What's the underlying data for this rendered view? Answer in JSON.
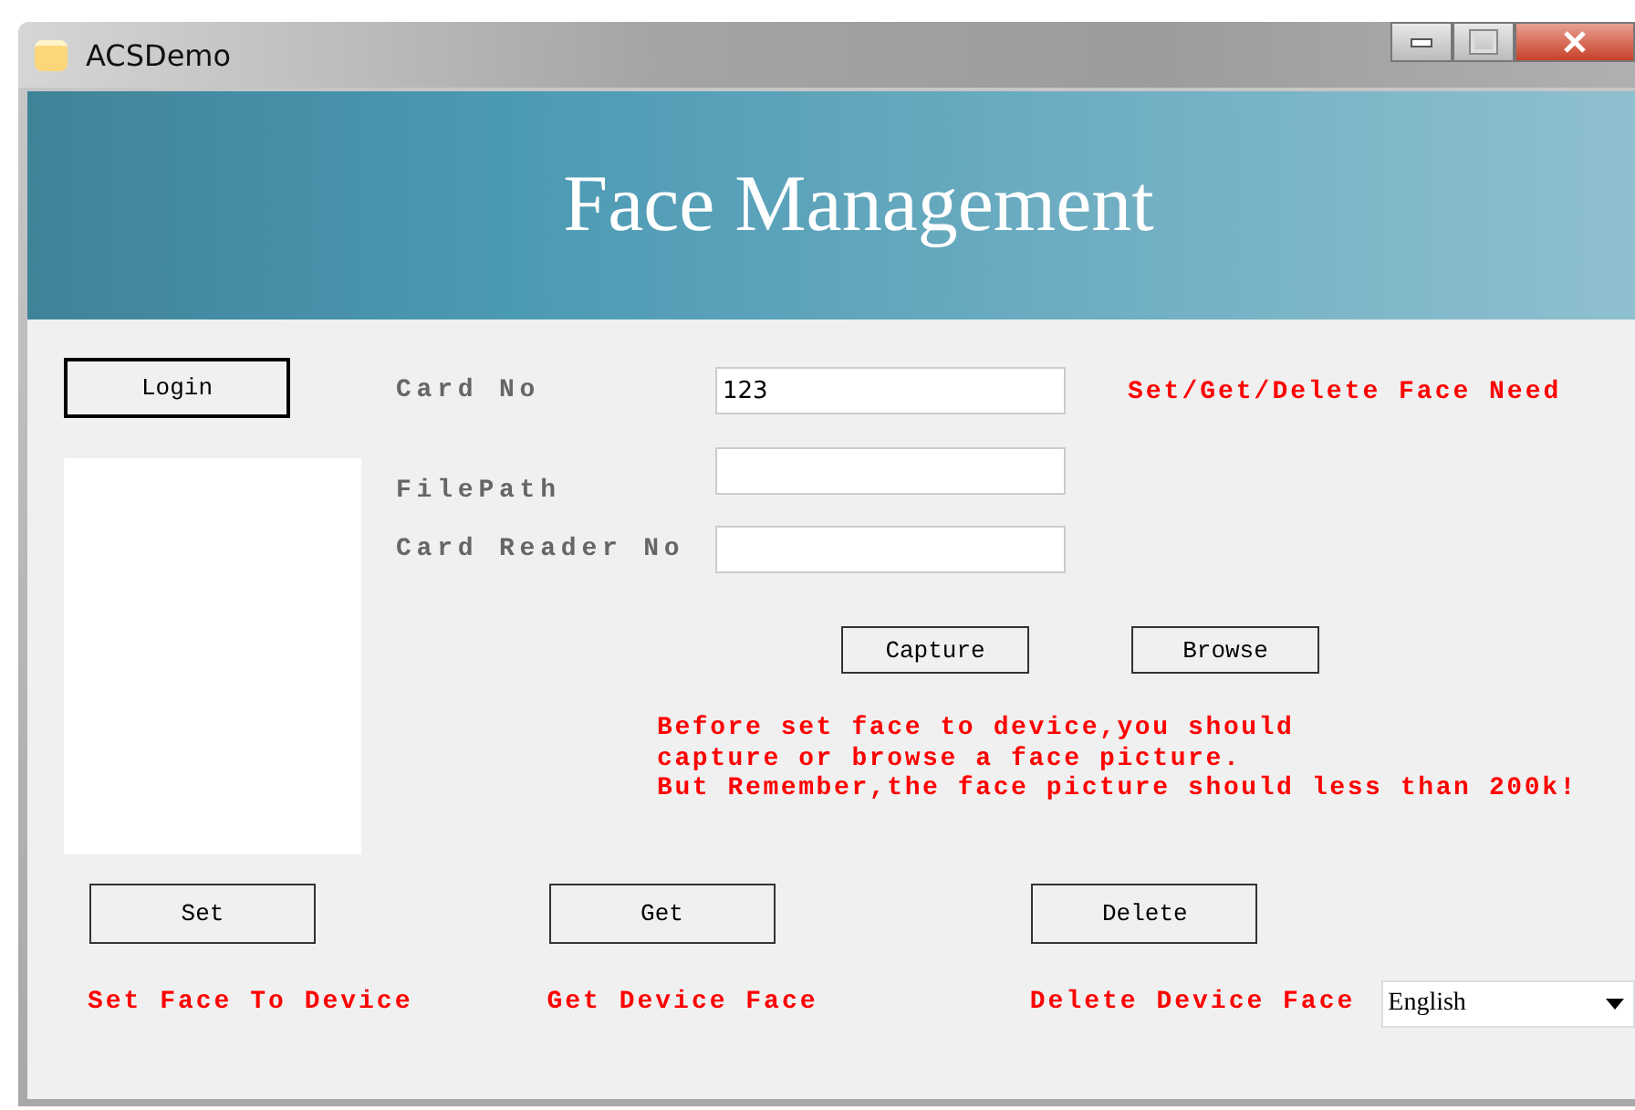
{
  "window": {
    "title": "ACSDemo"
  },
  "banner": {
    "title": "Face Management"
  },
  "login_button": "Login",
  "fields": [
    {
      "label": "Card No",
      "value": "123"
    },
    {
      "label": "FilePath"
    },
    {
      "label": "Card Reader No"
    }
  ],
  "note": "Set/Get/Delete Face Need",
  "picture_buttons": [
    "Capture",
    "Browse"
  ],
  "message": [
    "Before set face to device,you should",
    "capture or browse a face picture.",
    "But Remember,the face picture should less than 200k!"
  ],
  "actions": [
    {
      "button": "Set",
      "caption": "Set Face To Device"
    },
    {
      "button": "Get",
      "caption": "Get Device Face"
    },
    {
      "button": "Delete",
      "caption": "Delete Device Face"
    }
  ],
  "language": {
    "value": "English"
  }
}
